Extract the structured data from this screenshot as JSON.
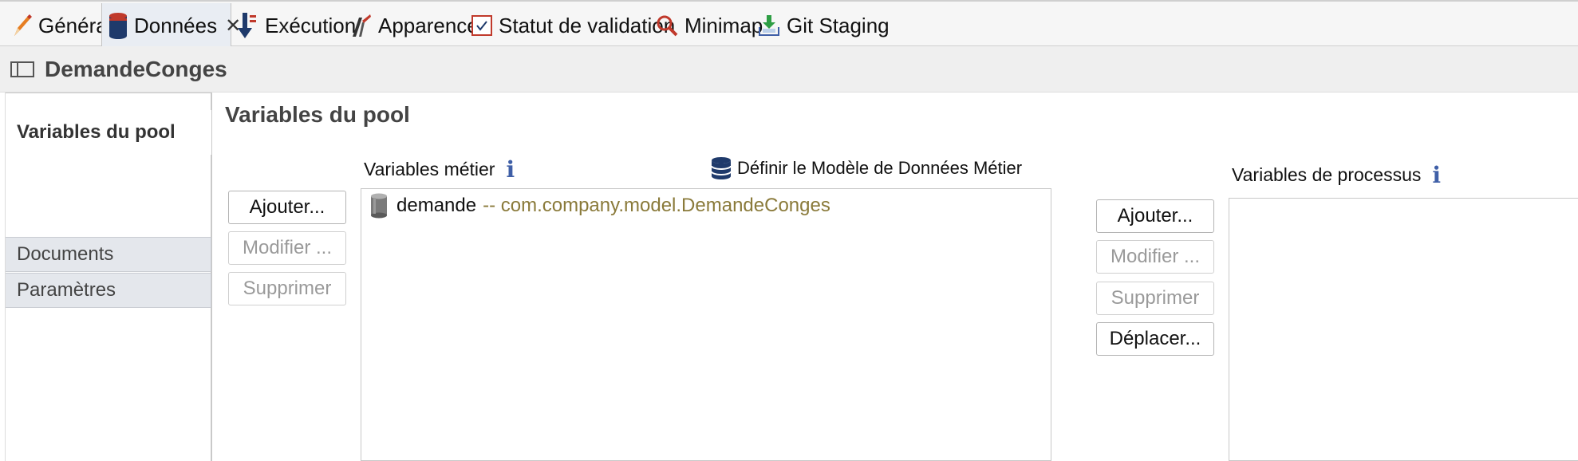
{
  "tabs": [
    {
      "label": "Général",
      "icon": "pencil-icon",
      "active": false
    },
    {
      "label": "Données",
      "icon": "data-cylinder-icon",
      "active": true,
      "closable": true
    },
    {
      "label": "Exécution",
      "icon": "execution-arrow-icon",
      "active": false
    },
    {
      "label": "Apparence",
      "icon": "appearance-brush-icon",
      "active": false
    },
    {
      "label": "Statut de validation",
      "icon": "validation-check-icon",
      "active": false
    },
    {
      "label": "Minimap",
      "icon": "magnifier-icon",
      "active": false
    },
    {
      "label": "Git Staging",
      "icon": "git-staging-icon",
      "active": false
    }
  ],
  "editor": {
    "title": "DemandeConges"
  },
  "sidebar": {
    "items": [
      {
        "label": "Variables du pool",
        "active": true
      },
      {
        "label": "Documents",
        "active": false
      },
      {
        "label": "Paramètres",
        "active": false
      }
    ]
  },
  "main": {
    "section_title": "Variables du pool",
    "business": {
      "label": "Variables métier",
      "bdm_link": "Définir le Modèle de Données Métier",
      "buttons": {
        "add": "Ajouter...",
        "edit": "Modifier ...",
        "delete": "Supprimer"
      },
      "rows": [
        {
          "name": "demande",
          "type": "-- com.company.model.DemandeConges"
        }
      ]
    },
    "process": {
      "label": "Variables de processus",
      "buttons": {
        "add": "Ajouter...",
        "edit": "Modifier ...",
        "delete": "Supprimer",
        "move": "Déplacer..."
      }
    }
  },
  "colors": {
    "accent_info": "#3f5fa7",
    "type_text": "#8a7a3a",
    "disabled_text": "#9a9a9a"
  }
}
